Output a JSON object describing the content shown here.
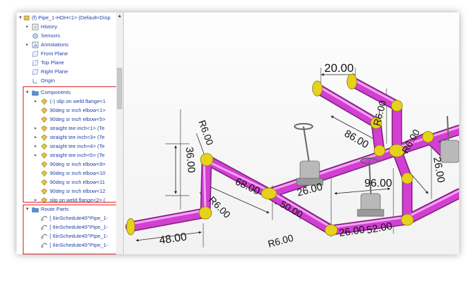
{
  "tree": {
    "root": "(f) Pipe_1-HOH<1> (Default<Disp",
    "items": [
      {
        "label": "History"
      },
      {
        "label": "Sensors"
      },
      {
        "label": "Annotations"
      },
      {
        "label": "Front Plane"
      },
      {
        "label": "Top Plane"
      },
      {
        "label": "Right Plane"
      },
      {
        "label": "Origin"
      }
    ],
    "components_folder": "Components",
    "components": [
      {
        "label": "(-) slip on weld flange<1"
      },
      {
        "label": "90deg sr inch elbow<1>"
      },
      {
        "label": "90deg sr inch elbow<5>"
      },
      {
        "label": "straight tee inch<1> (Te"
      },
      {
        "label": "straight tee inch<3> (Te"
      },
      {
        "label": "straight tee inch<4> (Te"
      },
      {
        "label": "straight tee inch<5> (Te"
      },
      {
        "label": "90deg sr inch elbow<9>"
      },
      {
        "label": "90deg sr inch elbow<10"
      },
      {
        "label": "90deg sr inch elbow<11"
      },
      {
        "label": "90deg sr inch elbow<12"
      },
      {
        "label": "slip on weld flange<2> ("
      }
    ],
    "route_folder": "Route Parts",
    "route_parts": [
      {
        "label": "[ 6inSchedule40^Pipe_1-"
      },
      {
        "label": "[ 6inSchedule40^Pipe_1-"
      },
      {
        "label": "[ 6inSchedule40^Pipe_1-"
      },
      {
        "label": "[ 6inSchedule40^Pipe_1-"
      }
    ]
  },
  "dimensions": {
    "d1": "20.00",
    "d2": "R6.00",
    "d3": "R6.00",
    "d4": "86.00",
    "d5": "36.00",
    "d6": "68.00",
    "d7": "R6.00",
    "d8": "26.00",
    "d9": "96.00",
    "d10": "26.00",
    "d11": "50.00",
    "d12": "48.00",
    "d13": "R6.00",
    "d14": "26.00",
    "d15": "52.00",
    "d16": "R6.00"
  },
  "colors": {
    "pipe": "#cc33cc",
    "fitting": "#e6d21a",
    "highlight": "#e02020",
    "folder": "#5b8fd6"
  }
}
